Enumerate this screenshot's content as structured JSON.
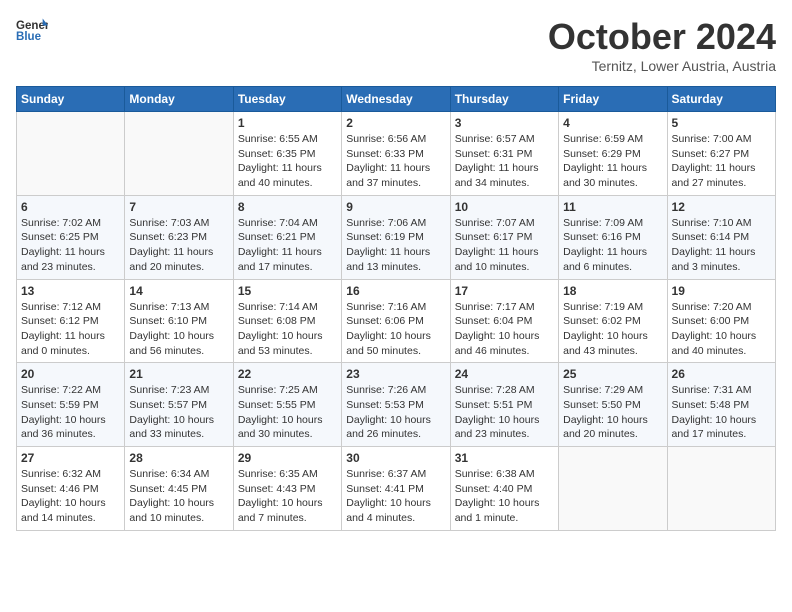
{
  "logo": {
    "line1": "General",
    "line2": "Blue"
  },
  "title": "October 2024",
  "subtitle": "Ternitz, Lower Austria, Austria",
  "days_of_week": [
    "Sunday",
    "Monday",
    "Tuesday",
    "Wednesday",
    "Thursday",
    "Friday",
    "Saturday"
  ],
  "weeks": [
    [
      {
        "day": "",
        "info": ""
      },
      {
        "day": "",
        "info": ""
      },
      {
        "day": "1",
        "info": "Sunrise: 6:55 AM\nSunset: 6:35 PM\nDaylight: 11 hours and 40 minutes."
      },
      {
        "day": "2",
        "info": "Sunrise: 6:56 AM\nSunset: 6:33 PM\nDaylight: 11 hours and 37 minutes."
      },
      {
        "day": "3",
        "info": "Sunrise: 6:57 AM\nSunset: 6:31 PM\nDaylight: 11 hours and 34 minutes."
      },
      {
        "day": "4",
        "info": "Sunrise: 6:59 AM\nSunset: 6:29 PM\nDaylight: 11 hours and 30 minutes."
      },
      {
        "day": "5",
        "info": "Sunrise: 7:00 AM\nSunset: 6:27 PM\nDaylight: 11 hours and 27 minutes."
      }
    ],
    [
      {
        "day": "6",
        "info": "Sunrise: 7:02 AM\nSunset: 6:25 PM\nDaylight: 11 hours and 23 minutes."
      },
      {
        "day": "7",
        "info": "Sunrise: 7:03 AM\nSunset: 6:23 PM\nDaylight: 11 hours and 20 minutes."
      },
      {
        "day": "8",
        "info": "Sunrise: 7:04 AM\nSunset: 6:21 PM\nDaylight: 11 hours and 17 minutes."
      },
      {
        "day": "9",
        "info": "Sunrise: 7:06 AM\nSunset: 6:19 PM\nDaylight: 11 hours and 13 minutes."
      },
      {
        "day": "10",
        "info": "Sunrise: 7:07 AM\nSunset: 6:17 PM\nDaylight: 11 hours and 10 minutes."
      },
      {
        "day": "11",
        "info": "Sunrise: 7:09 AM\nSunset: 6:16 PM\nDaylight: 11 hours and 6 minutes."
      },
      {
        "day": "12",
        "info": "Sunrise: 7:10 AM\nSunset: 6:14 PM\nDaylight: 11 hours and 3 minutes."
      }
    ],
    [
      {
        "day": "13",
        "info": "Sunrise: 7:12 AM\nSunset: 6:12 PM\nDaylight: 11 hours and 0 minutes."
      },
      {
        "day": "14",
        "info": "Sunrise: 7:13 AM\nSunset: 6:10 PM\nDaylight: 10 hours and 56 minutes."
      },
      {
        "day": "15",
        "info": "Sunrise: 7:14 AM\nSunset: 6:08 PM\nDaylight: 10 hours and 53 minutes."
      },
      {
        "day": "16",
        "info": "Sunrise: 7:16 AM\nSunset: 6:06 PM\nDaylight: 10 hours and 50 minutes."
      },
      {
        "day": "17",
        "info": "Sunrise: 7:17 AM\nSunset: 6:04 PM\nDaylight: 10 hours and 46 minutes."
      },
      {
        "day": "18",
        "info": "Sunrise: 7:19 AM\nSunset: 6:02 PM\nDaylight: 10 hours and 43 minutes."
      },
      {
        "day": "19",
        "info": "Sunrise: 7:20 AM\nSunset: 6:00 PM\nDaylight: 10 hours and 40 minutes."
      }
    ],
    [
      {
        "day": "20",
        "info": "Sunrise: 7:22 AM\nSunset: 5:59 PM\nDaylight: 10 hours and 36 minutes."
      },
      {
        "day": "21",
        "info": "Sunrise: 7:23 AM\nSunset: 5:57 PM\nDaylight: 10 hours and 33 minutes."
      },
      {
        "day": "22",
        "info": "Sunrise: 7:25 AM\nSunset: 5:55 PM\nDaylight: 10 hours and 30 minutes."
      },
      {
        "day": "23",
        "info": "Sunrise: 7:26 AM\nSunset: 5:53 PM\nDaylight: 10 hours and 26 minutes."
      },
      {
        "day": "24",
        "info": "Sunrise: 7:28 AM\nSunset: 5:51 PM\nDaylight: 10 hours and 23 minutes."
      },
      {
        "day": "25",
        "info": "Sunrise: 7:29 AM\nSunset: 5:50 PM\nDaylight: 10 hours and 20 minutes."
      },
      {
        "day": "26",
        "info": "Sunrise: 7:31 AM\nSunset: 5:48 PM\nDaylight: 10 hours and 17 minutes."
      }
    ],
    [
      {
        "day": "27",
        "info": "Sunrise: 6:32 AM\nSunset: 4:46 PM\nDaylight: 10 hours and 14 minutes."
      },
      {
        "day": "28",
        "info": "Sunrise: 6:34 AM\nSunset: 4:45 PM\nDaylight: 10 hours and 10 minutes."
      },
      {
        "day": "29",
        "info": "Sunrise: 6:35 AM\nSunset: 4:43 PM\nDaylight: 10 hours and 7 minutes."
      },
      {
        "day": "30",
        "info": "Sunrise: 6:37 AM\nSunset: 4:41 PM\nDaylight: 10 hours and 4 minutes."
      },
      {
        "day": "31",
        "info": "Sunrise: 6:38 AM\nSunset: 4:40 PM\nDaylight: 10 hours and 1 minute."
      },
      {
        "day": "",
        "info": ""
      },
      {
        "day": "",
        "info": ""
      }
    ]
  ]
}
